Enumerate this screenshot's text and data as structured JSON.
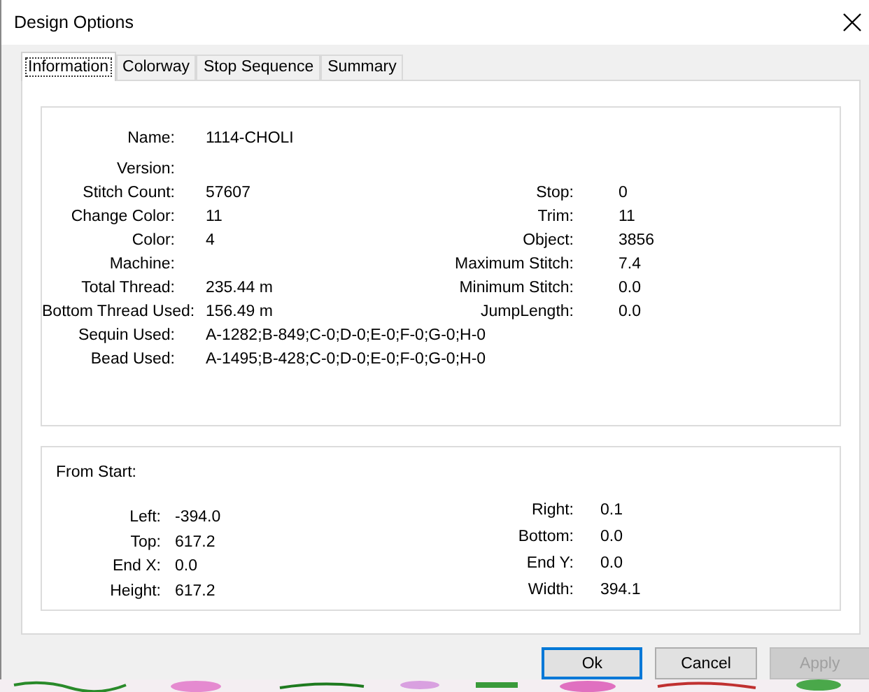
{
  "window": {
    "title": "Design Options"
  },
  "tabs": [
    {
      "label": "Information",
      "selected": true
    },
    {
      "label": "Colorway",
      "selected": false
    },
    {
      "label": "Stop Sequence",
      "selected": false
    },
    {
      "label": "Summary",
      "selected": false
    }
  ],
  "information": {
    "rows": [
      {
        "left": {
          "label": "Name:",
          "value": "1114-CHOLI"
        }
      },
      {
        "left": {
          "label": "Version:"
        }
      },
      {
        "left": {
          "label": "Stitch Count:",
          "value": "57607"
        },
        "right": {
          "label": "Stop:",
          "value": "0"
        }
      },
      {
        "left": {
          "label": "Change Color:",
          "value": "11"
        },
        "right": {
          "label": "Trim:",
          "value": "11"
        }
      },
      {
        "left": {
          "label": "Color:",
          "value": "4"
        },
        "right": {
          "label": "Object:",
          "value": "3856"
        }
      },
      {
        "left": {
          "label": "Machine:"
        },
        "right": {
          "label": "Maximum Stitch:",
          "value": "7.4"
        }
      },
      {
        "left": {
          "label": "Total Thread:",
          "value": "235.44 m"
        },
        "right": {
          "label": "Minimum Stitch:",
          "value": "0.0"
        }
      },
      {
        "left": {
          "label": "Bottom Thread Used:",
          "value": "156.49 m"
        },
        "right": {
          "label": "JumpLength:",
          "value": "0.0"
        }
      },
      {
        "left": {
          "label": "Sequin Used:",
          "value": "A-1282;B-849;C-0;D-0;E-0;F-0;G-0;H-0"
        }
      },
      {
        "left": {
          "label": "Bead Used:",
          "value": "A-1495;B-428;C-0;D-0;E-0;F-0;G-0;H-0"
        }
      }
    ]
  },
  "from_start": {
    "title": "From Start:",
    "left": [
      {
        "label": "Left:",
        "value": "-394.0"
      },
      {
        "label": "Top:",
        "value": "617.2"
      },
      {
        "label": "End X:",
        "value": "0.0"
      },
      {
        "label": "Height:",
        "value": "617.2"
      }
    ],
    "right": [
      {
        "label": "Right:",
        "value": "0.1"
      },
      {
        "label": "Bottom:",
        "value": "0.0"
      },
      {
        "label": "End Y:",
        "value": "0.0"
      },
      {
        "label": "Width:",
        "value": "394.1"
      }
    ]
  },
  "buttons": [
    {
      "label": "Ok",
      "focused": true,
      "disabled": false
    },
    {
      "label": "Cancel",
      "focused": false,
      "disabled": false
    },
    {
      "label": "Apply",
      "focused": false,
      "disabled": true
    }
  ]
}
